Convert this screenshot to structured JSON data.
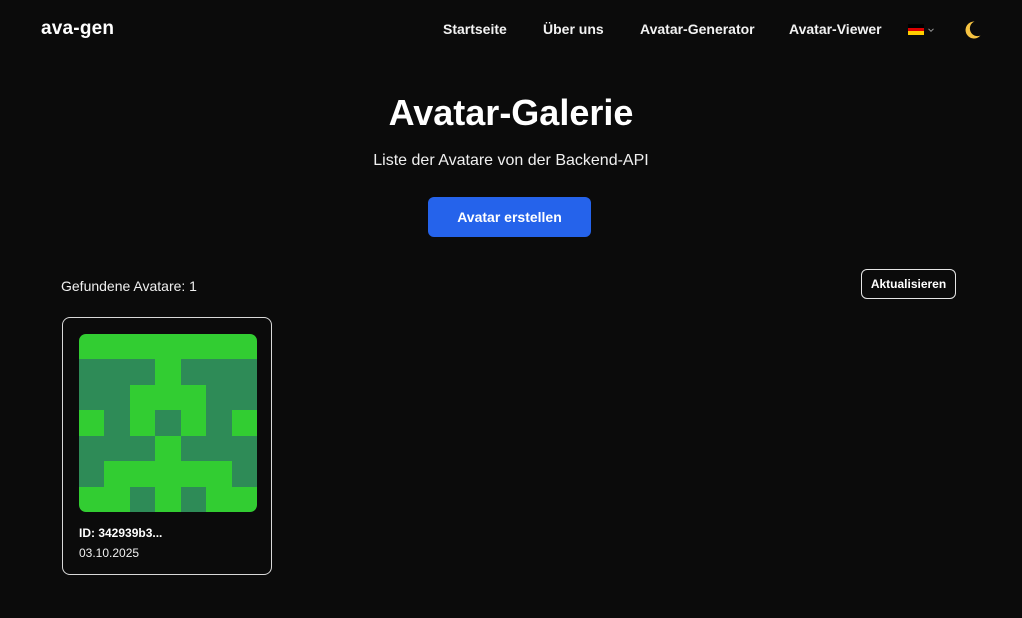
{
  "header": {
    "brand": "ava-gen",
    "nav": [
      "Startseite",
      "Über uns",
      "Avatar-Generator",
      "Avatar-Viewer"
    ],
    "language_flag": "german-flag",
    "theme_icon": "moon-icon"
  },
  "hero": {
    "title": "Avatar-Galerie",
    "subtitle": "Liste der Avatare von der Backend-API",
    "create_button": "Avatar erstellen"
  },
  "gallery": {
    "count_label": "Gefundene Avatare: 1",
    "refresh_button": "Aktualisieren",
    "items": [
      {
        "id": "ID: 342939b3...",
        "date": "03.10.2025",
        "pixels": [
          "1111111",
          "0001000",
          "0011100",
          "1010101",
          "0001000",
          "0111110",
          "1101011"
        ],
        "colors": {
          "on": "#32cd32",
          "off": "#2e8b57"
        }
      }
    ]
  },
  "colors": {
    "background": "#0b0b0b",
    "accent": "#2563eb"
  }
}
